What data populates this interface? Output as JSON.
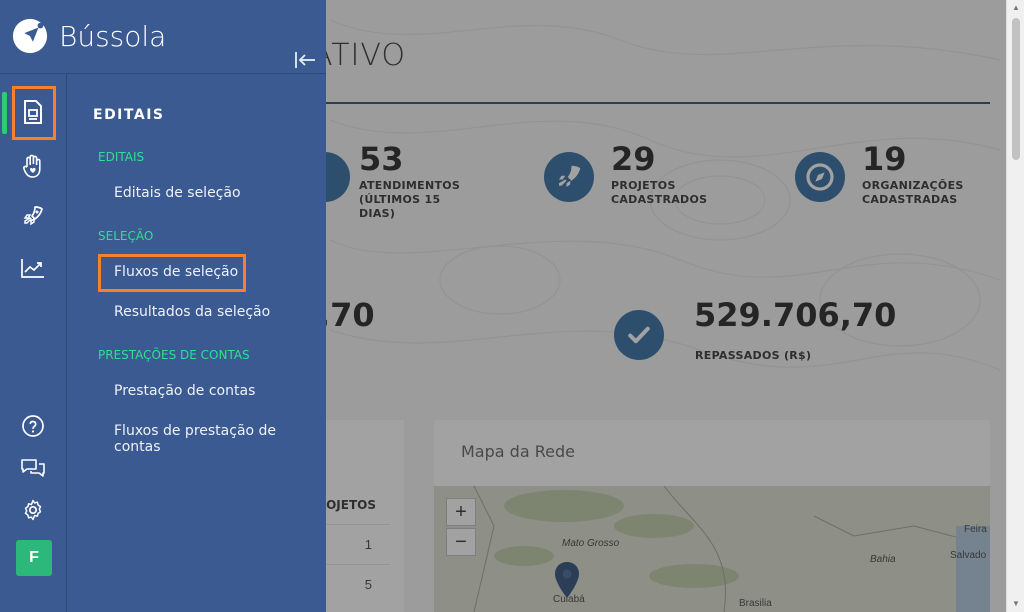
{
  "brand": {
    "name": "Bússola"
  },
  "main": {
    "title_fragment": "ATIVO",
    "stats": [
      {
        "value": "53",
        "label": "ATENDIMENTOS (ÚLTIMOS 15 DIAS)"
      },
      {
        "value": "29",
        "label": "PROJETOS CADASTRADOS"
      },
      {
        "value": "19",
        "label": "ORGANIZAÇÕES CADASTRADAS"
      }
    ],
    "amount_left_fragment": ",70",
    "amount_right": {
      "value": "529.706,70",
      "label": "REPASSADOS (R$)"
    },
    "table": {
      "header_fragment": "OJETOS",
      "rows": [
        "1",
        "5"
      ]
    },
    "map": {
      "title": "Mapa da Rede",
      "zoom_in": "+",
      "zoom_out": "−",
      "labels": {
        "mato_grosso": "Mato Grosso",
        "bahia": "Bahia",
        "feira": "Feira",
        "salvador": "Salvado",
        "cuiaba": "Cuiabá",
        "brasilia": "Brasilia"
      }
    }
  },
  "sidebar": {
    "submenu_title": "EDITAIS",
    "sections": [
      {
        "heading": "EDITAIS",
        "items": [
          "Editais de seleção"
        ]
      },
      {
        "heading": "SELEÇÃO",
        "items": [
          "Fluxos de seleção",
          "Resultados da seleção"
        ]
      },
      {
        "heading": "PRESTAÇÕES DE CONTAS",
        "items": [
          "Prestação de contas",
          "Fluxos de prestação de contas"
        ]
      }
    ],
    "avatar_initial": "F"
  },
  "colors": {
    "sidebar_bg": "#3a5a91",
    "section_heading": "#2ee08f",
    "highlight": "#f5822a",
    "active_indicator": "#2ecc71",
    "avatar_bg": "#2bb87a",
    "stat_icon": "#1f5f9a"
  },
  "icons": {
    "rail": [
      "document-icon",
      "hand-heart-icon",
      "rocket-icon",
      "chart-line-icon",
      "help-circle-icon",
      "chat-icon",
      "gear-icon"
    ]
  }
}
